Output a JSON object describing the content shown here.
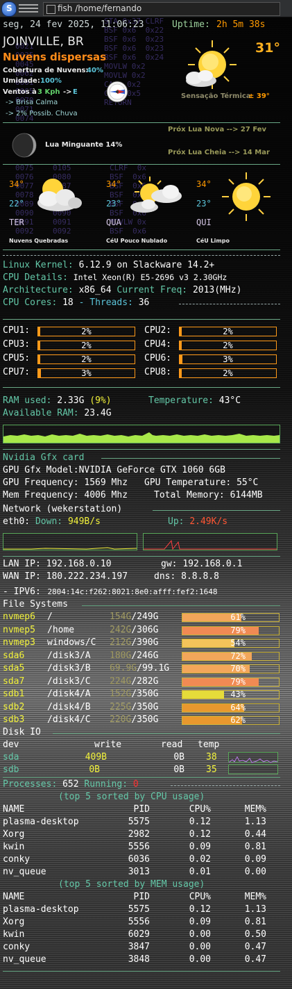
{
  "taskbar": {
    "start_label": "S",
    "window_title": "fish /home/fernando"
  },
  "header": {
    "datetime": "seg, 24 fev 2025, 11:06:23",
    "uptime_label": "Uptime:",
    "uptime_value": "2h 5m 38s"
  },
  "weather": {
    "city": "JOINVILLE, BR",
    "condition": "Nuvens dispersas",
    "temperature": "31°",
    "cloud_label": "Cobertura de Nuvens:",
    "cloud_value": "40%",
    "humidity_label": "Umidade:",
    "humidity_value": "100%",
    "wind_label": "Ventos à",
    "wind_speed": "3 Kph",
    "wind_arrow": "->",
    "wind_dir": "E",
    "breeze": "-> Brisa Calma",
    "rain": "-> 2% Possib. Chuva",
    "feels_label": "Sensação Térmica",
    "feels_value": "± 39°",
    "moon_phase": "Lua Minguante 14%",
    "next_new_moon": "Próx Lua Nova  --> 27 Fev",
    "next_full_moon": "Próx Lua Cheia --> 14 Mar",
    "forecast": [
      {
        "hi": "34°",
        "lo": "22°",
        "day": "TER",
        "desc": "Nuvens Quebradas",
        "icon": "cloudy-sun-icon"
      },
      {
        "hi": "34°",
        "lo": "23°",
        "day": "QUA",
        "desc": "CéU Pouco Nublado",
        "icon": "partly-cloudy-icon"
      },
      {
        "hi": "34°",
        "lo": "23°",
        "day": "QUI",
        "desc": "CéU Limpo",
        "icon": "sun-icon"
      }
    ]
  },
  "system": {
    "kernel_label": "Linux Kernel:",
    "kernel_value": "6.12.9 on Slackware 14.2+",
    "cpu_label": "CPU Details:",
    "cpu_value": "Intel Xeon(R)  E5-2696 v3  2.30GHz",
    "arch_label": "Architecture:",
    "arch_value": "x86_64",
    "freq_label": "Current Freq:",
    "freq_value": "2013(MHz)",
    "cores_label": "CPU Cores:",
    "cores_value": "18",
    "threads_label": "- Threads:",
    "threads_value": "36"
  },
  "cpus": [
    {
      "label": "CPU1:",
      "pct": "2%",
      "fraction": 0.02
    },
    {
      "label": "CPU2:",
      "pct": "2%",
      "fraction": 0.02
    },
    {
      "label": "CPU3:",
      "pct": "2%",
      "fraction": 0.02
    },
    {
      "label": "CPU4:",
      "pct": "2%",
      "fraction": 0.02
    },
    {
      "label": "CPU5:",
      "pct": "2%",
      "fraction": 0.02
    },
    {
      "label": "CPU6:",
      "pct": "3%",
      "fraction": 0.03
    },
    {
      "label": "CPU7:",
      "pct": "3%",
      "fraction": 0.03
    },
    {
      "label": "CPU8:",
      "pct": "2%",
      "fraction": 0.02
    }
  ],
  "memory": {
    "ram_label": "RAM used:",
    "ram_value": "2.33G",
    "ram_pct": "(9%)",
    "temp_label": "Temperature:",
    "temp_value": "43°C",
    "avail_label": "Available RAM:",
    "avail_value": "23.4G"
  },
  "gpu": {
    "section": "Nvidia Gfx card",
    "model_label": "GPU Gfx Model:",
    "model_value": "NVIDIA GeForce GTX 1060 6GB",
    "freq_label": "GPU Frequency:",
    "freq_value": "1569 Mhz",
    "temp_label": "GPU Temperature:",
    "temp_value": "55°C",
    "mem_label": "Mem Frequency:",
    "mem_value": "4006 Mhz",
    "total_label": "Total Memory:",
    "total_value": "6144MB"
  },
  "network": {
    "section": "Network (wekerstation)",
    "iface": "eth0:",
    "down_label": "Down:",
    "down_value": "949B/s",
    "up_label": "Up:",
    "up_value": "2.49K/s",
    "lan_label": "LAN IP:",
    "lan_value": "192.168.0.10",
    "gw_label": "gw:",
    "gw_value": "192.168.0.1",
    "wan_label": "WAN IP:",
    "wan_value": "180.222.234.197",
    "dns_label": "dns:",
    "dns_value": "8.8.8.8",
    "ipv6_label": "- IPV6:",
    "ipv6_value": "2804:14c:f262:8021:8e0:afff:fef2:1648"
  },
  "filesystems": {
    "section": "File Systems",
    "rows": [
      {
        "dev": "nvmep6",
        "mount": "/",
        "used": "154G",
        "size": "249G",
        "pct": "61%",
        "fraction": 0.61,
        "color": "#f2a65a"
      },
      {
        "dev": "nvmep5",
        "mount": "/home",
        "used": "242G",
        "size": "306G",
        "pct": "79%",
        "fraction": 0.79,
        "color": "#f08a54"
      },
      {
        "dev": "nvmep3",
        "mount": "windows/C",
        "used": "212G",
        "size": "390G",
        "pct": "54%",
        "fraction": 0.54,
        "color": "#f4c35a"
      },
      {
        "dev": "sda6",
        "mount": "/disk3/A",
        "used": "180G",
        "size": "246G",
        "pct": "72%",
        "fraction": 0.72,
        "color": "#f2a65a"
      },
      {
        "dev": "sda5",
        "mount": "/disk3/B",
        "used": "69.9G",
        "size": "99.1G",
        "pct": "70%",
        "fraction": 0.7,
        "color": "#f2a65a"
      },
      {
        "dev": "sda7",
        "mount": "/disk3/C",
        "used": "224G",
        "size": "282G",
        "pct": "79%",
        "fraction": 0.79,
        "color": "#f08a54"
      },
      {
        "dev": "sdb1",
        "mount": "/disk4/A",
        "used": "152G",
        "size": "350G",
        "pct": "43%",
        "fraction": 0.43,
        "color": "#e6dc3a"
      },
      {
        "dev": "sdb2",
        "mount": "/disk4/B",
        "used": "225G",
        "size": "350G",
        "pct": "64%",
        "fraction": 0.64,
        "color": "#e8982e"
      },
      {
        "dev": "sdb3",
        "mount": "/disk4/C",
        "used": "220G",
        "size": "350G",
        "pct": "62%",
        "fraction": 0.62,
        "color": "#e8982e"
      }
    ]
  },
  "diskio": {
    "section": "Disk IO",
    "headers": [
      "dev",
      "write",
      "read",
      "temp"
    ],
    "rows": [
      {
        "dev": "sda",
        "write": "409B",
        "read": "0B",
        "temp": "38"
      },
      {
        "dev": "sdb",
        "write": "0B",
        "read": "0B",
        "temp": "35"
      }
    ]
  },
  "processes": {
    "label": "Processes:",
    "count": "652",
    "running_label": "Running:",
    "running": "0",
    "cpu_title": "(top 5 sorted by CPU usage)",
    "mem_title": "(top 5 sorted by MEM usage)",
    "headers": [
      "NAME",
      "PID",
      "CPU%",
      "MEM%"
    ],
    "by_cpu": [
      [
        "plasma-desktop",
        "5575",
        "0.12",
        "1.13"
      ],
      [
        "Xorg",
        "2982",
        "0.12",
        "0.44"
      ],
      [
        "kwin",
        "5556",
        "0.09",
        "0.81"
      ],
      [
        "conky",
        "6036",
        "0.02",
        "0.09"
      ],
      [
        "nv_queue",
        "3013",
        "0.01",
        "0.00"
      ]
    ],
    "by_mem": [
      [
        "plasma-desktop",
        "5575",
        "0.12",
        "1.13"
      ],
      [
        "Xorg",
        "5556",
        "0.09",
        "0.81"
      ],
      [
        "kwin",
        "6029",
        "0.00",
        "0.50"
      ],
      [
        "conky",
        "3847",
        "0.00",
        "0.47"
      ],
      [
        "nv_queue",
        "3848",
        "0.00",
        "0.47"
      ]
    ]
  }
}
